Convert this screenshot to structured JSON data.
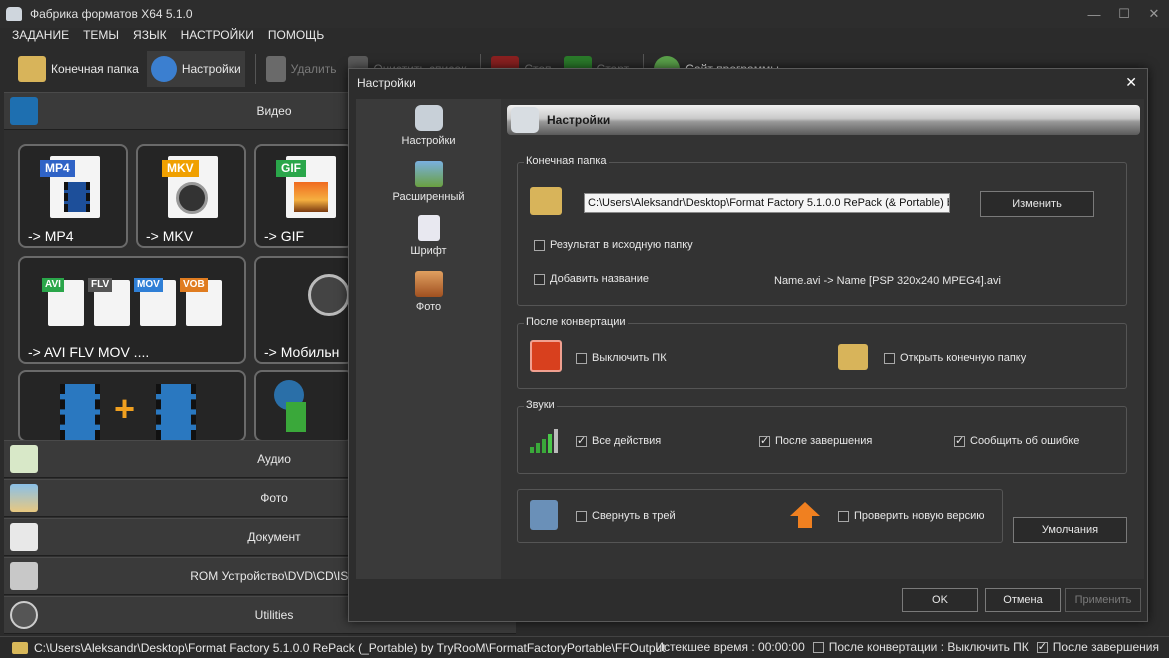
{
  "window": {
    "title": "Фабрика форматов X64 5.1.0",
    "minimize": "—",
    "maximize": "☐",
    "close": "✕"
  },
  "menu": [
    "ЗАДАНИЕ",
    "ТЕМЫ",
    "ЯЗЫК",
    "НАСТРОЙКИ",
    "ПОМОЩЬ"
  ],
  "toolbar": {
    "output_folder": "Конечная папка",
    "settings": "Настройки",
    "delete": "Удалить",
    "clear": "Очистить список",
    "stop": "Стоп",
    "start": "Старт",
    "site": "Сайт программы"
  },
  "left": {
    "video_header": "Видео",
    "audio_header": "Аудио",
    "photo_header": "Фото",
    "document_header": "Документ",
    "rom_header": "ROM Устройство\\DVD\\CD\\ISO",
    "utilities_header": "Utilities",
    "tiles": {
      "mp4_tag": "MP4",
      "mp4_label": "-> MP4",
      "mkv_tag": "MKV",
      "mkv_label": "-> MKV",
      "gif_tag": "GIF",
      "gif_label": "-> GIF",
      "multi_tags": [
        "AVI",
        "FLV",
        "MOV",
        "VOB"
      ],
      "multi_label": "-> AVI FLV MOV ....",
      "mobile_label": "-> Мобильн"
    }
  },
  "dialog": {
    "title": "Настройки",
    "close": "✕",
    "nav": [
      "Настройки",
      "Расширенный",
      "Шрифт",
      "Фото"
    ],
    "header": "Настройки",
    "output_group": {
      "label": "Конечная папка",
      "path": "C:\\Users\\Aleksandr\\Desktop\\Format Factory 5.1.0.0 RePack (& Portable) b",
      "change_btn": "Изменить",
      "result_in_source": "Результат в исходную папку",
      "add_name": "Добавить название",
      "name_example": "Name.avi  -> Name [PSP 320x240 MPEG4].avi"
    },
    "after_group": {
      "label": "После конвертации",
      "shutdown": "Выключить ПК",
      "open_folder": "Открыть конечную папку"
    },
    "sounds_group": {
      "label": "Звуки",
      "all_actions": "Все действия",
      "after_finish": "После завершения",
      "report_error": "Сообщить об ошибке"
    },
    "misc_group": {
      "tray": "Свернуть в трей",
      "check_version": "Проверить новую версию"
    },
    "defaults_btn": "Умолчания",
    "ok": "OK",
    "cancel": "Отмена",
    "apply": "Применить"
  },
  "status": {
    "path": "C:\\Users\\Aleksandr\\Desktop\\Format Factory 5.1.0.0 RePack (_Portable) by TryRooM\\FormatFactoryPortable\\FFOutput",
    "elapsed": "Истекшее время : 00:00:00",
    "after_conv": "После конвертации : Выключить ПК",
    "after_finish": "После завершения"
  },
  "colors": {
    "mp4_tag": "#2f63c6",
    "mkv_tag": "#f0a000",
    "gif_tag": "#2aa64a",
    "avi_tag": "#2aa64a",
    "flv_tag": "#555555",
    "mov_tag": "#2f7fd6",
    "vob_tag": "#e07c20"
  }
}
